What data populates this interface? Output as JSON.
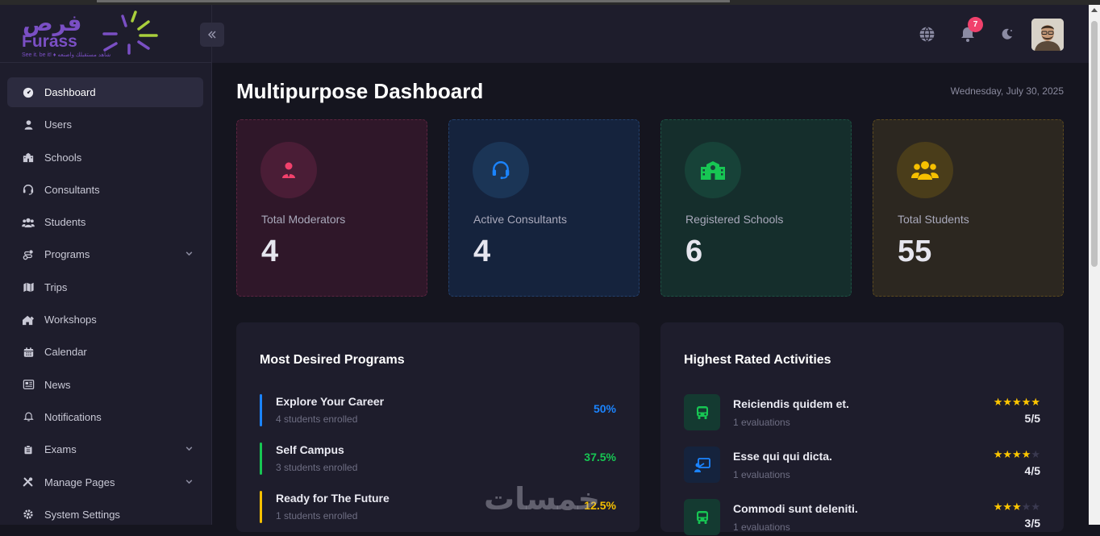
{
  "logo": {
    "arabic": "فرص",
    "name": "Furass",
    "tagline": "See it. be it! ♦ شاهد مستقبلك واصنعه"
  },
  "sidebar": {
    "items": [
      {
        "label": "Dashboard",
        "icon": "dashboard-icon",
        "active": true
      },
      {
        "label": "Users",
        "icon": "user-icon"
      },
      {
        "label": "Schools",
        "icon": "school-icon"
      },
      {
        "label": "Consultants",
        "icon": "headset-icon"
      },
      {
        "label": "Students",
        "icon": "users-icon"
      },
      {
        "label": "Programs",
        "icon": "route-icon",
        "expandable": true
      },
      {
        "label": "Trips",
        "icon": "map-icon"
      },
      {
        "label": "Workshops",
        "icon": "home-tools-icon"
      },
      {
        "label": "Calendar",
        "icon": "calendar-icon"
      },
      {
        "label": "News",
        "icon": "newspaper-icon"
      },
      {
        "label": "Notifications",
        "icon": "bell-icon"
      },
      {
        "label": "Exams",
        "icon": "clipboard-icon",
        "expandable": true
      },
      {
        "label": "Manage Pages",
        "icon": "tools-icon",
        "expandable": true
      },
      {
        "label": "System Settings",
        "icon": "gear-icon"
      }
    ]
  },
  "header": {
    "notification_count": "7"
  },
  "page": {
    "title": "Multipurpose Dashboard",
    "date": "Wednesday, July 30, 2025"
  },
  "stats": [
    {
      "label": "Total Moderators",
      "value": "4",
      "color": "#f1416c"
    },
    {
      "label": "Active Consultants",
      "value": "4",
      "color": "#1b84ff"
    },
    {
      "label": "Registered Schools",
      "value": "6",
      "color": "#17c653"
    },
    {
      "label": "Total Students",
      "value": "55",
      "color": "#f6c000"
    }
  ],
  "programs": {
    "title": "Most Desired Programs",
    "items": [
      {
        "name": "Explore Your Career",
        "enrolled": "4 students enrolled",
        "percent": "50%",
        "color": "#1b84ff"
      },
      {
        "name": "Self Campus",
        "enrolled": "3 students enrolled",
        "percent": "37.5%",
        "color": "#17c653"
      },
      {
        "name": "Ready for The Future",
        "enrolled": "1 students enrolled",
        "percent": "12.5%",
        "color": "#f6c000"
      }
    ]
  },
  "activities": {
    "title": "Highest Rated Activities",
    "items": [
      {
        "name": "Reiciendis quidem et.",
        "evaluations": "1 evaluations",
        "rating": 5,
        "score": "5/5",
        "icon": "bus-icon"
      },
      {
        "name": "Esse qui qui dicta.",
        "evaluations": "1 evaluations",
        "rating": 4,
        "score": "4/5",
        "icon": "presentation-icon"
      },
      {
        "name": "Commodi sunt deleniti.",
        "evaluations": "1 evaluations",
        "rating": 3,
        "score": "3/5",
        "icon": "bus-icon"
      }
    ]
  },
  "watermark": "خمسات"
}
